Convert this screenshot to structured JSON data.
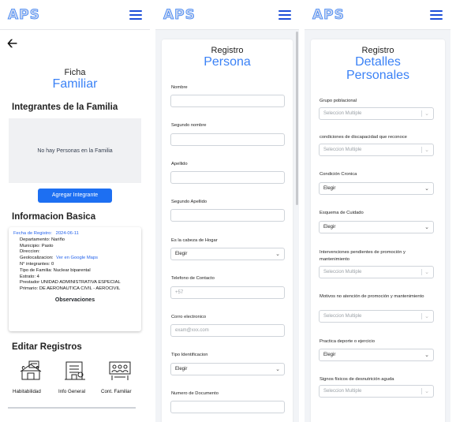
{
  "logo": "APS",
  "panel1": {
    "title_small": "Ficha",
    "title_large": "Familiar",
    "members_heading": "Integrantes de la Familia",
    "empty_text": "No hay Personas en la Familia",
    "add_button": "Agregar Integrante",
    "basic_heading": "Informacion Basica",
    "info": {
      "fecha_label": "Fecha de Registro:",
      "fecha_value": "2024-06-11",
      "departamento": "Departamento: Nariño",
      "municipio": "Municipio: Pasto",
      "direccion": "Direccion:",
      "geo_label": "Geolocalizacion:",
      "geo_link": "Ver en Google Maps",
      "integrantes": "N° integrantes:  0",
      "tipo_familia": "Tipo de Familia:  Nuclear biparental",
      "estrato": "Estrato:  4",
      "prestador": "Prestador  UNIDAD ADMINISTRATIVA ESPECIAL",
      "primario": "Primario:  DE AERONÁUTICA CIVIL - AEROCIVIL"
    },
    "observaciones": "Observaciones",
    "edit_heading": "Editar Registros",
    "edit_items": [
      {
        "label": "Habitabilidad",
        "icon": "house-plants-icon"
      },
      {
        "label": "Info General",
        "icon": "office-building-icon"
      },
      {
        "label": "Cont. Familiar",
        "icon": "family-map-icon"
      }
    ]
  },
  "panel2": {
    "title_small": "Registro",
    "title_large": "Persona",
    "fields": [
      {
        "label": "Nombre",
        "value": "",
        "placeholder": ""
      },
      {
        "label": "Segundo nombre",
        "value": "",
        "placeholder": ""
      },
      {
        "label": "Apellido",
        "value": "",
        "placeholder": ""
      },
      {
        "label": "Segundo Apellido",
        "value": "",
        "placeholder": ""
      },
      {
        "label": "Es la cabeza de Hogar",
        "select": "Elegir"
      },
      {
        "label": "Telefono de Contacto",
        "value": "",
        "placeholder": "+57"
      },
      {
        "label": "Corro electronico",
        "value": "",
        "placeholder": "exam@xxx.com"
      },
      {
        "label": "Tipo Identificacion",
        "select": "Elegir"
      },
      {
        "label": "Numero de Documento",
        "value": "",
        "placeholder": ""
      }
    ]
  },
  "panel3": {
    "title_small": "Registro",
    "title_large_1": "Detalles",
    "title_large_2": "Personales",
    "fields": [
      {
        "label": "Grupo poblacional",
        "multi": "Seleccion Multiple"
      },
      {
        "label": "condiciones de discapacidad que reconoce",
        "multi": "Seleccion Multiple"
      },
      {
        "label": "Condición Cronica",
        "select": "Elegir"
      },
      {
        "label": "Esquema de Cuidado",
        "select": "Elegir"
      },
      {
        "label": "Intervenciones pendientes de promoción y mantenimiento",
        "multi": "Seleccion Multiple"
      },
      {
        "label": "Motivos no atención de promoción y mantenimiento",
        "multi": "Seleccion Multiple"
      },
      {
        "label": "Practica deporte o ejercicio",
        "select": "Elegir"
      },
      {
        "label": "Signos físicos de desnutrición aguda",
        "multi": "Seleccion Multiple"
      }
    ]
  }
}
